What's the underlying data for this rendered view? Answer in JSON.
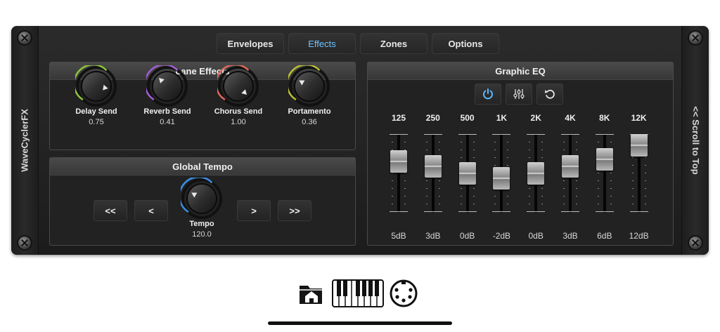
{
  "app": {
    "name": "WaveCyclerFX",
    "scroll_label": "<< Scroll to Top"
  },
  "tabs": [
    {
      "label": "Envelopes",
      "active": false
    },
    {
      "label": "Effects",
      "active": true
    },
    {
      "label": "Zones",
      "active": false
    },
    {
      "label": "Options",
      "active": false
    }
  ],
  "lane_effects": {
    "title": "Lane Effects",
    "knobs": [
      {
        "label": "Delay Send",
        "value": "0.75",
        "ring_color": "#8fc63a"
      },
      {
        "label": "Reverb Send",
        "value": "0.41",
        "ring_color": "#a25ed6"
      },
      {
        "label": "Chorus Send",
        "value": "1.00",
        "ring_color": "#e06a5c"
      },
      {
        "label": "Portamento",
        "value": "0.36",
        "ring_color": "#b8c034"
      }
    ]
  },
  "global_tempo": {
    "title": "Global Tempo",
    "buttons": [
      "<<",
      "<",
      ">",
      ">>"
    ],
    "knob_label": "Tempo",
    "knob_value": "120.0",
    "ring_color": "#3b8fe8"
  },
  "graphic_eq": {
    "title": "Graphic EQ",
    "tools": [
      "power-icon",
      "sliders-icon",
      "reset-icon"
    ],
    "accent": "#5bb8ff",
    "bands": [
      {
        "freq": "125",
        "gain": "5dB",
        "level": 0.708
      },
      {
        "freq": "250",
        "gain": "3dB",
        "level": 0.625
      },
      {
        "freq": "500",
        "gain": "0dB",
        "level": 0.5
      },
      {
        "freq": "1K",
        "gain": "-2dB",
        "level": 0.417
      },
      {
        "freq": "2K",
        "gain": "0dB",
        "level": 0.5
      },
      {
        "freq": "4K",
        "gain": "3dB",
        "level": 0.625
      },
      {
        "freq": "8K",
        "gain": "6dB",
        "level": 0.75
      },
      {
        "freq": "12K",
        "gain": "12dB",
        "level": 1.0
      }
    ]
  },
  "dock": [
    {
      "icon": "folder-home-icon"
    },
    {
      "icon": "piano-keyboard-icon"
    },
    {
      "icon": "midi-connector-icon"
    }
  ]
}
